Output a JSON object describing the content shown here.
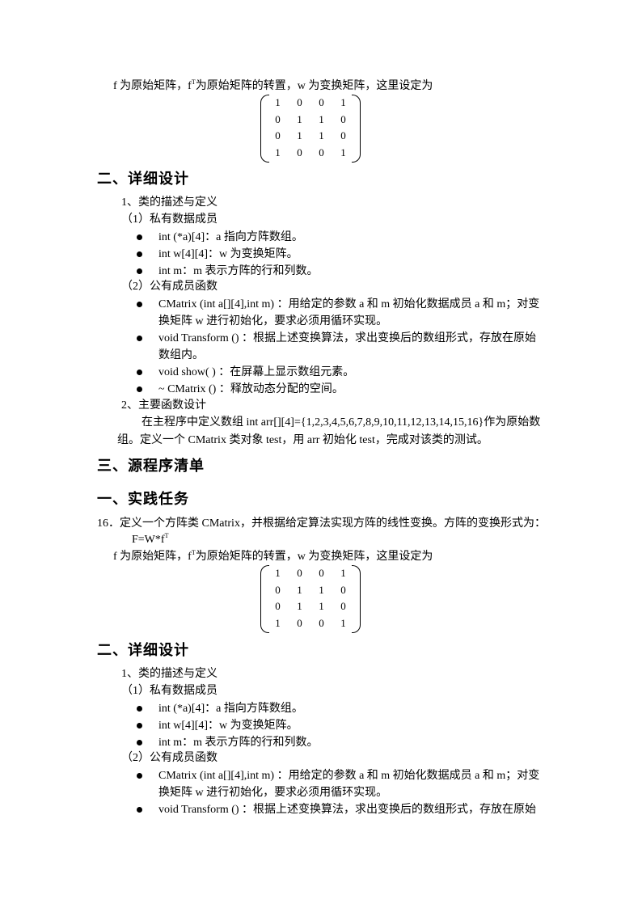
{
  "page1": {
    "intro_line_parts": [
      "f 为原始矩阵，f",
      "T",
      "为原始矩阵的转置，w 为变换矩阵，这里设定为"
    ],
    "matrix": [
      [
        1,
        0,
        0,
        1
      ],
      [
        0,
        1,
        1,
        0
      ],
      [
        0,
        1,
        1,
        0
      ],
      [
        1,
        0,
        0,
        1
      ]
    ],
    "section2_title": "二、详细设计",
    "sub1_title": "1、类的描述与定义",
    "private_title": "（1）私有数据成员",
    "private_members": [
      "int (*a)[4]：a 指向方阵数组。",
      "int w[4][4]：w 为变换矩阵。",
      "int m：m 表示方阵的行和列数。"
    ],
    "public_title": "（2）公有成员函数",
    "public_members": [
      [
        "CMatrix (int a[][4],int m) ：用给定的参数 a 和 m  初始化数据成员 a 和 m；对变",
        "换矩阵 w 进行初始化，要求必须用循环实现。"
      ],
      [
        "void  Transform () ：根据上述变换算法，求出变换后的数组形式，存放在原始",
        "数组内。"
      ],
      [
        "void show( ) ：在屏幕上显示数组元素。"
      ],
      [
        "~ CMatrix () ：释放动态分配的空间。"
      ]
    ],
    "sub2_title": "2、主要函数设计",
    "main_design_lines": [
      "在主程序中定义数组 int  arr[][4]={1,2,3,4,5,6,7,8,9,10,11,12,13,14,15,16}作为原始数",
      "组。定义一个 CMatrix 类对象 test，用 arr 初始化 test，完成对该类的测试。"
    ],
    "section3_title": "三、源程序清单"
  },
  "page2": {
    "section1_title": "一、实践任务",
    "task_line": "16．定义一个方阵类 CMatrix，并根据给定算法实现方阵的线性变换。方阵的变换形式为：",
    "formula_parts": [
      "F=W*f",
      "T"
    ],
    "intro_line_parts": [
      "f 为原始矩阵，f",
      "T",
      "为原始矩阵的转置，w 为变换矩阵，这里设定为"
    ],
    "matrix": [
      [
        1,
        0,
        0,
        1
      ],
      [
        0,
        1,
        1,
        0
      ],
      [
        0,
        1,
        1,
        0
      ],
      [
        1,
        0,
        0,
        1
      ]
    ],
    "section2_title": "二、详细设计",
    "sub1_title": "1、类的描述与定义",
    "private_title": "（1）私有数据成员",
    "private_members": [
      "int (*a)[4]：a 指向方阵数组。",
      "int w[4][4]：w 为变换矩阵。",
      "int m：m 表示方阵的行和列数。"
    ],
    "public_title": "（2）公有成员函数",
    "public_members": [
      [
        "CMatrix (int a[][4],int m) ：用给定的参数 a 和 m  初始化数据成员 a 和 m；对变",
        "换矩阵 w 进行初始化，要求必须用循环实现。"
      ],
      [
        "void  Transform () ：根据上述变换算法，求出变换后的数组形式，存放在原始"
      ]
    ]
  }
}
